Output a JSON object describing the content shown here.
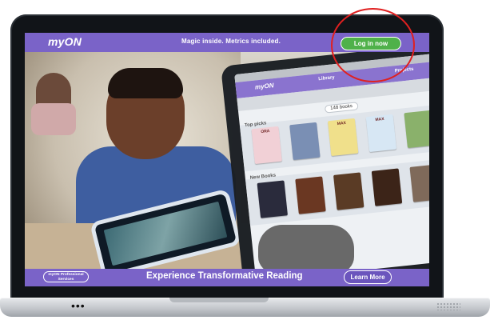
{
  "topbar": {
    "logo_text": "myON",
    "tagline": "Magic inside. Metrics included.",
    "login_label": "Log in now"
  },
  "ipad": {
    "logo_text": "myON",
    "tab_library": "Library",
    "tab_projects": "Projects",
    "book_count": "148 books",
    "shelf_top_label": "Top picks",
    "shelf_new_label": "New Books",
    "book_titles": [
      "ORA",
      "MAX",
      "MAX"
    ]
  },
  "bottombar": {
    "services_label": "myON Professional Services",
    "headline": "Experience Transformative Reading",
    "learn_more_label": "Learn More"
  },
  "laptop": {
    "base_dots": "•••"
  },
  "colors": {
    "brand_purple": "#7a63c8",
    "login_green": "#4fb14a",
    "highlight_red": "#e02020"
  }
}
